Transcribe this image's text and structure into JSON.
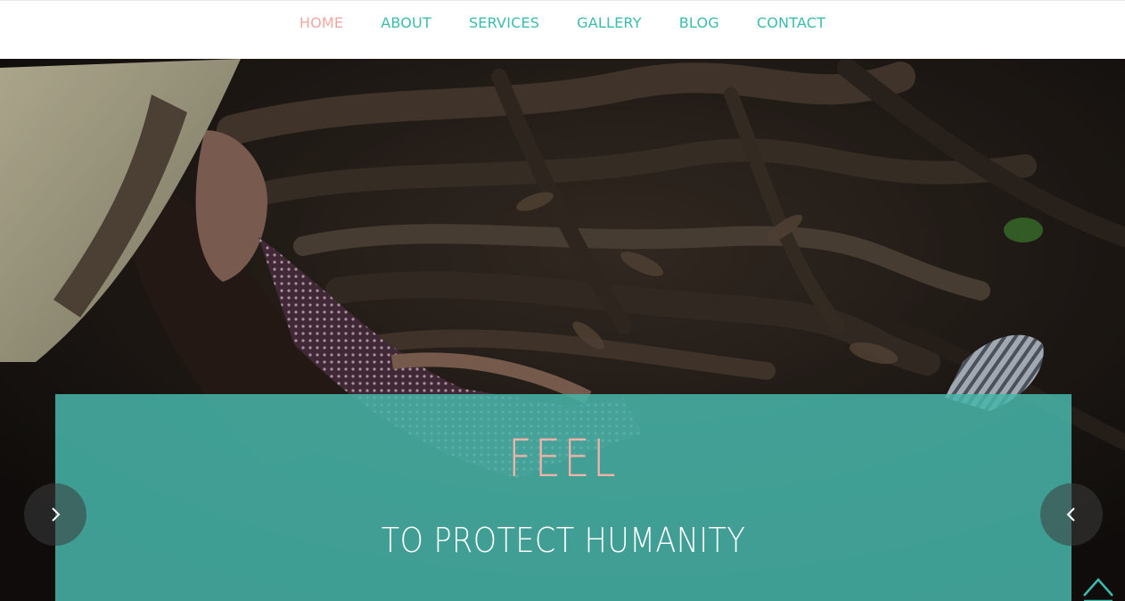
{
  "nav": {
    "items": [
      {
        "label": "HOME",
        "active": true
      },
      {
        "label": "ABOUT",
        "active": false
      },
      {
        "label": "SERVICES",
        "active": false
      },
      {
        "label": "GALLERY",
        "active": false
      },
      {
        "label": "BLOG",
        "active": false
      },
      {
        "label": "CONTACT",
        "active": false
      }
    ]
  },
  "hero": {
    "title": "FEEL",
    "subtitle": "TO PROTECT HUMANITY",
    "next_icon": "chevron-right-icon",
    "prev_icon": "chevron-left-icon",
    "scroll_top_icon": "chevron-up-icon"
  },
  "colors": {
    "accent": "#3bbcae",
    "active": "#f3a7a0",
    "caption_bg": "#47b6aa",
    "title": "#f6b2a8"
  }
}
